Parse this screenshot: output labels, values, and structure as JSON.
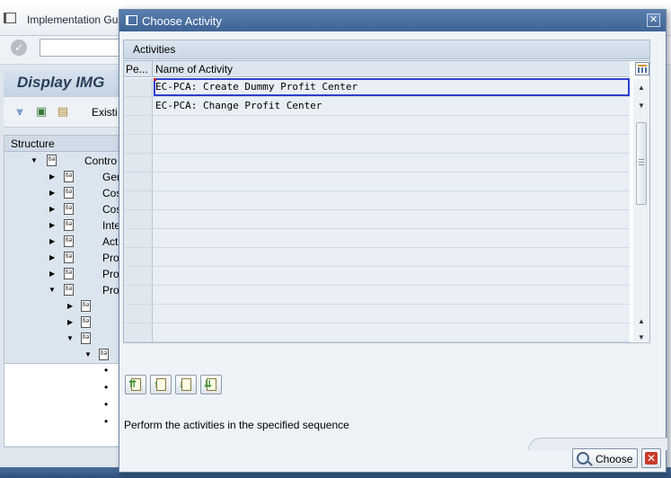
{
  "background": {
    "menu_label": "Implementation Gu",
    "page_title": "Display IMG",
    "toolbar_existing": "Existi",
    "structure_label": "Structure",
    "tree_rows": [
      {
        "label": "Contro"
      },
      {
        "label": "Ger"
      },
      {
        "label": "Cos"
      },
      {
        "label": "Cos"
      },
      {
        "label": "Inte"
      },
      {
        "label": "Act"
      },
      {
        "label": "Pro"
      },
      {
        "label": "Pro"
      },
      {
        "label": "Pro"
      }
    ]
  },
  "dialog": {
    "title": "Choose Activity",
    "close_glyph": "✕",
    "tab_label": "Activities",
    "table": {
      "columns": [
        "Pe...",
        "Name of Activity"
      ],
      "rows": [
        {
          "name": "EC-PCA: Create Dummy Profit Center"
        },
        {
          "name": "EC-PCA: Change Profit Center"
        }
      ]
    },
    "footer_text": "Perform the activities in the specified sequence",
    "choose_label": "Choose",
    "cancel_glyph": "✕"
  },
  "icons": {
    "seq_buttons": [
      "move-to-top-icon",
      "move-up-icon",
      "move-down-icon",
      "move-to-bottom-icon"
    ]
  },
  "colors": {
    "dialog_title_bar": "#4a70a2",
    "focus_border": "#2a3ed0"
  }
}
